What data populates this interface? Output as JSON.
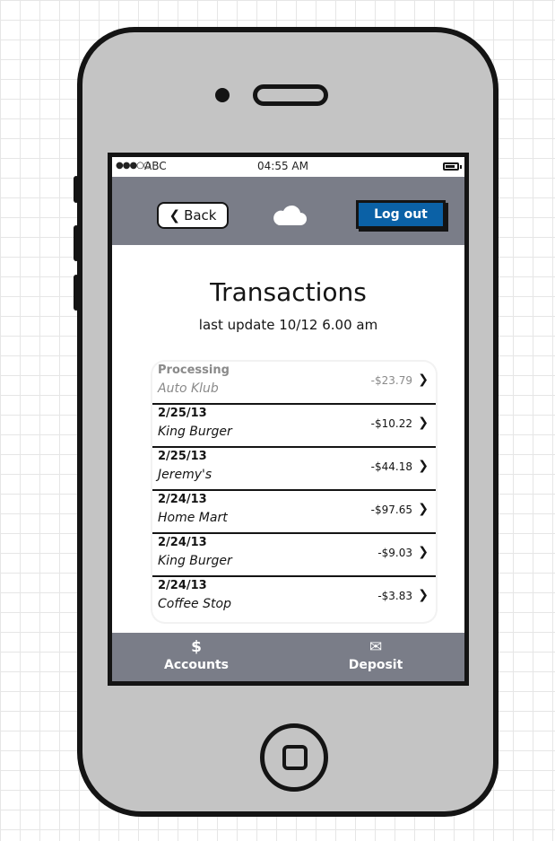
{
  "status_bar": {
    "signal": "●●●○○",
    "carrier": "ABC",
    "time": "04:55 AM"
  },
  "nav_bar": {
    "back_label": "Back",
    "logout_label": "Log out"
  },
  "header": {
    "title": "Transactions",
    "subtitle": "last update 10/12 6.00 am"
  },
  "transactions": [
    {
      "date": "Processing",
      "merchant": "Auto Klub",
      "amount": "-$23.79"
    },
    {
      "date": "2/25/13",
      "merchant": "King Burger",
      "amount": "-$10.22"
    },
    {
      "date": "2/25/13",
      "merchant": "Jeremy's",
      "amount": "-$44.18"
    },
    {
      "date": "2/24/13",
      "merchant": "Home Mart",
      "amount": "-$97.65"
    },
    {
      "date": "2/24/13",
      "merchant": "King Burger",
      "amount": "-$9.03"
    },
    {
      "date": "2/24/13",
      "merchant": "Coffee Stop",
      "amount": "-$3.83"
    }
  ],
  "tab_bar": {
    "accounts": {
      "icon": "$",
      "label": "Accounts"
    },
    "deposit": {
      "icon": "✉",
      "label": "Deposit"
    }
  },
  "colors": {
    "nav_background": "#7a7d88",
    "logout_button": "#0b61a6",
    "device_body": "#c4c4c4",
    "pending_text": "#8a8a8a"
  }
}
